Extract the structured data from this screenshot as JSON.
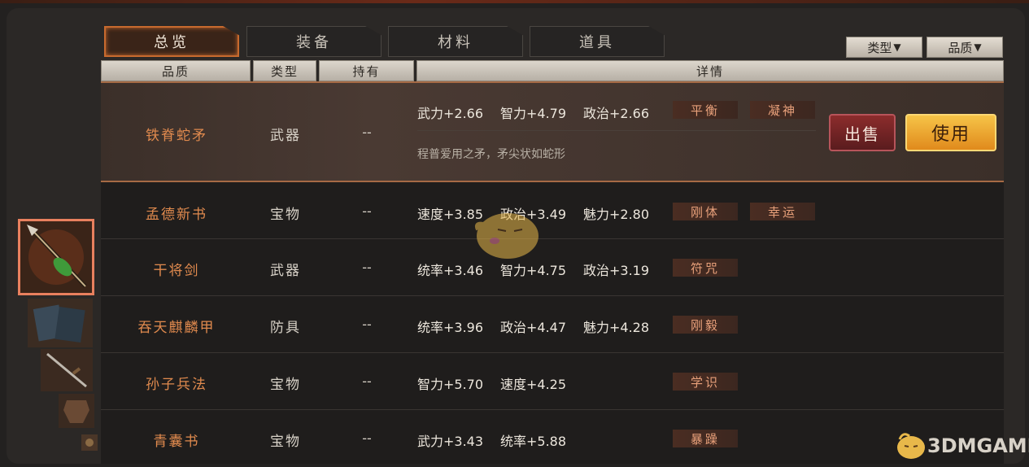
{
  "tabs": [
    {
      "label": "总览",
      "active": true
    },
    {
      "label": "装备",
      "active": false
    },
    {
      "label": "材料",
      "active": false
    },
    {
      "label": "道具",
      "active": false
    }
  ],
  "filters": [
    {
      "label": "类型",
      "arrow": "▼"
    },
    {
      "label": "品质",
      "arrow": "▼"
    }
  ],
  "columns": [
    "品质",
    "类型",
    "持有",
    "详情"
  ],
  "rows": [
    {
      "name": "铁脊蛇矛",
      "type": "武器",
      "hold": "--",
      "stats": [
        "武力+2.66",
        "智力+4.79",
        "政治+2.66"
      ],
      "traits": [
        "平衡",
        "凝神"
      ],
      "desc": "程普爱用之矛，矛尖状如蛇形",
      "selected": true
    },
    {
      "name": "孟德新书",
      "type": "宝物",
      "hold": "--",
      "stats": [
        "速度+3.85",
        "政治+3.49",
        "魅力+2.80"
      ],
      "traits": [
        "刚体",
        "幸运"
      ]
    },
    {
      "name": "干将剑",
      "type": "武器",
      "hold": "--",
      "stats": [
        "统率+3.46",
        "智力+4.75",
        "政治+3.19"
      ],
      "traits": [
        "符咒"
      ]
    },
    {
      "name": "吞天麒麟甲",
      "type": "防具",
      "hold": "--",
      "stats": [
        "统率+3.96",
        "政治+4.47",
        "魅力+4.28"
      ],
      "traits": [
        "刚毅"
      ]
    },
    {
      "name": "孙子兵法",
      "type": "宝物",
      "hold": "--",
      "stats": [
        "智力+5.70",
        "速度+4.25"
      ],
      "traits": [
        "学识"
      ]
    },
    {
      "name": "青囊书",
      "type": "宝物",
      "hold": "--",
      "stats": [
        "武力+3.43",
        "统率+5.88"
      ],
      "traits": [
        "暴躁"
      ]
    }
  ],
  "actions": {
    "sell": "出售",
    "use": "使用"
  },
  "watermark": "3DMGAME",
  "colors": {
    "accent": "#c86a2e",
    "name_text": "#e08a4e",
    "trait_text": "#e8a07a",
    "use_button": "#f0a830",
    "sell_button": "#7a2628"
  }
}
